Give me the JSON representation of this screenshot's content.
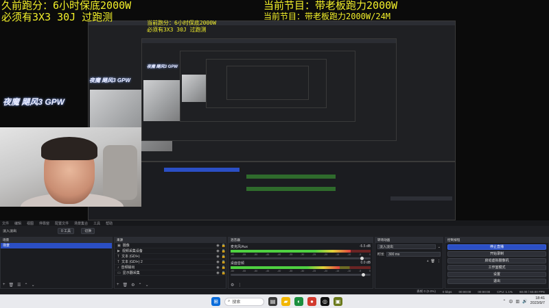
{
  "overlay": {
    "left_line1": "久前跑分：6小时保底2000W",
    "left_line2": "必须有3X3 30J 过跑测",
    "left_echo1": "当前跑分：6小时保底2000W",
    "left_echo2": "必须有3X3 30J 过跑测",
    "right_line1": "当前节目：带老板跑力2000W",
    "right_line2": "当前节目：带老板跑力2000W/24M",
    "brand": "夜魔 飓风3 GPW",
    "colors": {
      "overlay_text": "#f3f02a",
      "accent": "#2b4fc5"
    }
  },
  "obs": {
    "menu": [
      "文件",
      "编辑",
      "视图",
      "停靠窗",
      "配置文件",
      "场景集合",
      "工具",
      "帮助"
    ],
    "transition": {
      "label": "淡入淡出",
      "quick_a": "0 工具",
      "quick_b": "切换"
    },
    "scenes": {
      "title": "场景",
      "items": [
        {
          "label": "场景",
          "selected": true
        }
      ]
    },
    "sources": {
      "title": "来源",
      "items": [
        {
          "label": "摄像",
          "icon": "image-icon"
        },
        {
          "label": "视频采集设备",
          "icon": "camera-icon"
        },
        {
          "label": "文本 (GDI+)",
          "icon": "text-icon"
        },
        {
          "label": "文本 (GDI+) 2",
          "icon": "text-icon"
        },
        {
          "label": "音频输出",
          "icon": "speaker-icon"
        },
        {
          "label": "显示器采集",
          "icon": "monitor-icon"
        }
      ]
    },
    "mixer": {
      "title": "混音器",
      "channels": [
        {
          "name": "麦克风/Aux",
          "db": "-5.5 dB",
          "level": 0.86,
          "fader": 0.95
        },
        {
          "name": "桌面音频",
          "db": "0.0 dB",
          "level": 0.78,
          "fader": 0.96
        }
      ],
      "ticks": [
        "-60",
        "-55",
        "-50",
        "-45",
        "-40",
        "-35",
        "-30",
        "-25",
        "-20",
        "-15",
        "-10",
        "-5",
        "0"
      ]
    },
    "transitions_dock": {
      "title": "转场动画",
      "type": "淡入淡出",
      "duration_label": "时长",
      "duration": "300 ms"
    },
    "controls": {
      "title": "控制按钮",
      "buttons": [
        "停止直播",
        "开始录制",
        "启动虚拟摄像机",
        "工作室模式",
        "设置",
        "退出"
      ]
    },
    "status": {
      "dropped": "丢帧 0 (0.0%)",
      "bitrate": "0 kbps",
      "live_time": "00:00:00",
      "rec_time": "00:00:00",
      "cpu": "CPU: 1.1%",
      "fps": "60.00 / 60.00 FPS"
    }
  },
  "taskbar": {
    "search_placeholder": "搜索",
    "time": "18:41",
    "date": "2023/9/7",
    "tray_label": "中"
  }
}
